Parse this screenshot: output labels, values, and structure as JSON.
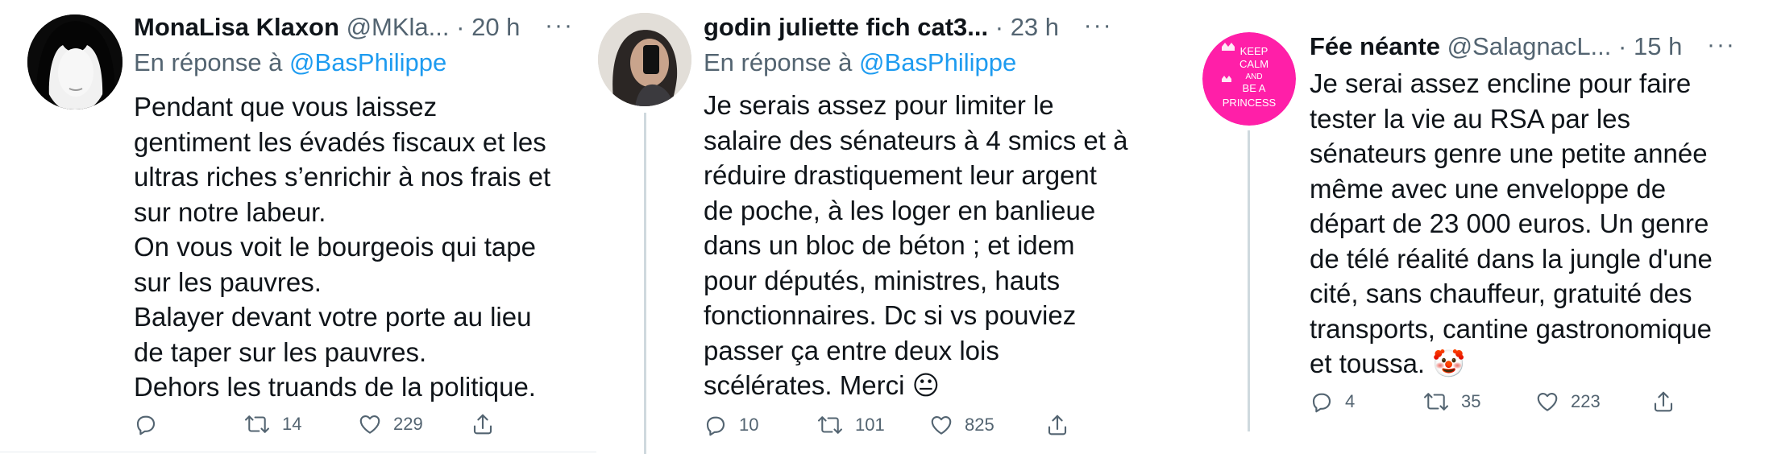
{
  "tweets": [
    {
      "name": "MonaLisa Klaxon",
      "handle": "@MKla...",
      "time": "20 h",
      "reply_prefix": "En réponse à",
      "reply_to": "@BasPhilippe",
      "lines": [
        "Pendant que vous laissez",
        "gentiment les évadés fiscaux et les",
        "ultras riches s’enrichir à nos frais et",
        "sur notre labeur.",
        "On vous voit le bourgeois qui tape",
        "sur les pauvres.",
        "Balayer devant votre porte au lieu",
        "de taper sur les pauvres.",
        "Dehors les truands de la politique."
      ],
      "replies": "",
      "retweets": "14",
      "likes": "229"
    },
    {
      "name": "godin juliette fich cat3...",
      "handle": "",
      "time": "23 h",
      "reply_prefix": "En réponse à",
      "reply_to": "@BasPhilippe",
      "lines": [
        "Je serais assez pour limiter le",
        "salaire des sénateurs à 4 smics et à",
        "réduire drastiquement leur argent",
        "de poche, à les loger en banlieue",
        "dans un bloc de béton ; et  idem",
        "pour députés, ministres, hauts",
        "fonctionnaires. Dc si vs pouviez",
        "passer ça entre deux lois",
        "scélérates. Merci 😐"
      ],
      "replies": "10",
      "retweets": "101",
      "likes": "825"
    },
    {
      "name": "Fée néante",
      "handle": "@SalagnacL...",
      "time": "15 h",
      "lines": [
        "Je serai assez encline pour faire",
        "tester la vie au RSA par les",
        "sénateurs genre une petite année",
        "même avec une enveloppe de",
        "départ de 23 000 euros. Un genre",
        "de télé réalité dans la jungle d'une",
        "cité, sans chauffeur, gratuité des",
        "transports, cantine gastronomique",
        "et toussa. 🤡"
      ],
      "replies": "4",
      "retweets": "35",
      "likes": "223",
      "avatar_text": [
        "KEEP",
        "CALM",
        "AND",
        "BE A",
        "PRINCESS"
      ],
      "avatar_color": "#ff1fa8"
    }
  ],
  "colors": {
    "text": "#0f1419",
    "secondary": "#536471",
    "link": "#1d9bf0",
    "thread_line": "#cfd9de"
  },
  "icons": {
    "reply": "reply-icon",
    "retweet": "retweet-icon",
    "like": "heart-icon",
    "share": "share-icon",
    "more": "more-icon"
  }
}
